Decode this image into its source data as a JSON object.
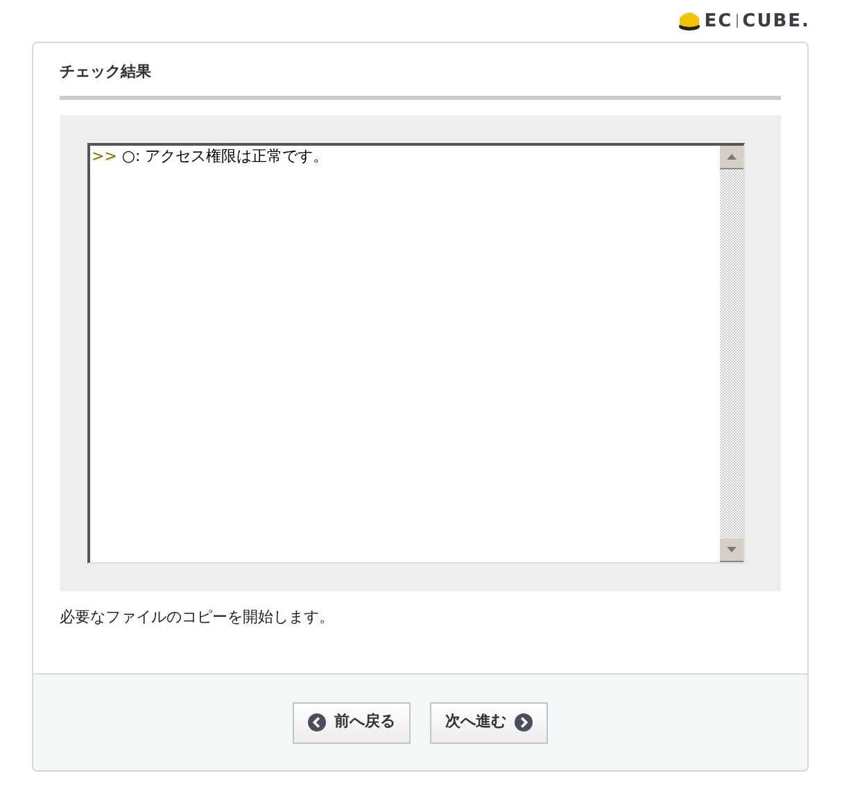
{
  "logo": {
    "left": "EC",
    "right": "CUBE."
  },
  "section": {
    "title": "チェック結果"
  },
  "log": {
    "prompt": ">>",
    "text": " ○: アクセス権限は正常です。"
  },
  "message": "必要なファイルのコピーを開始します。",
  "buttons": [
    {
      "kind": "back",
      "label": "前へ戻る"
    },
    {
      "kind": "next",
      "label": "次へ進む"
    }
  ]
}
